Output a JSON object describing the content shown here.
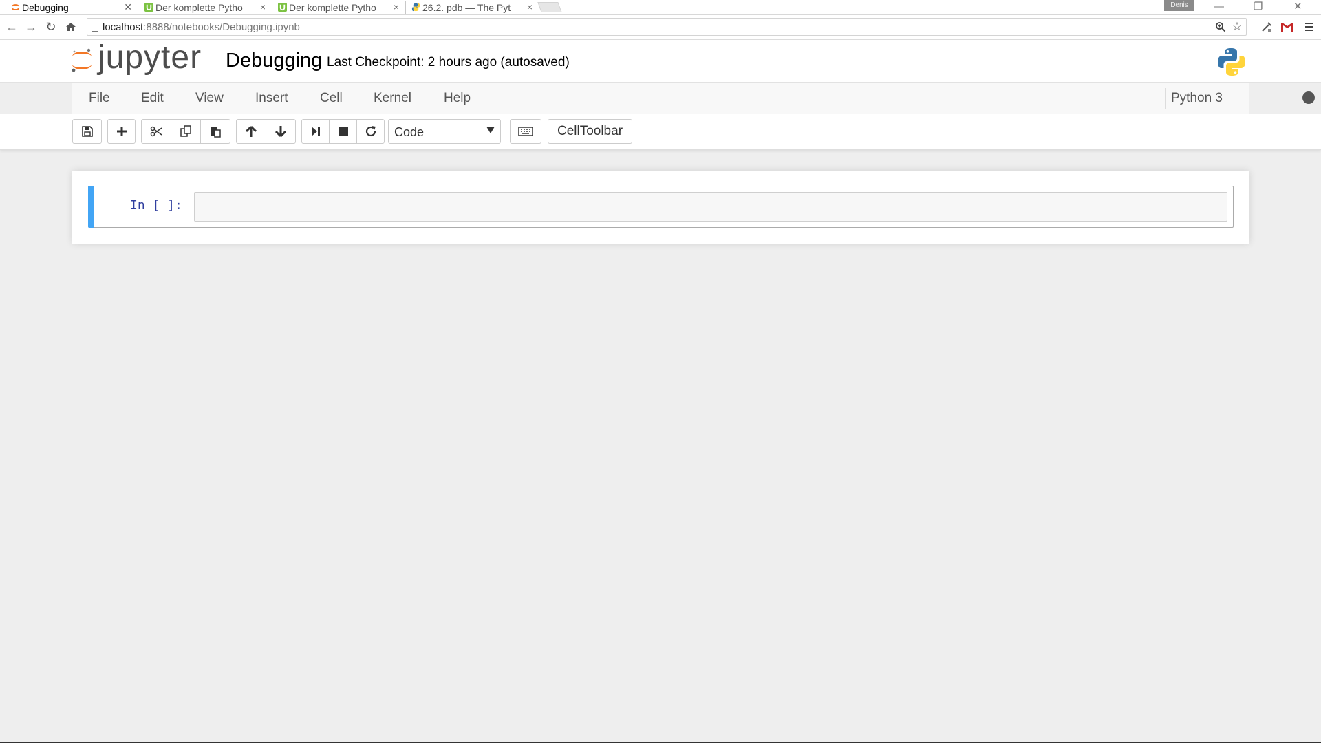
{
  "browser": {
    "tabs": [
      {
        "title": "Debugging",
        "active": true
      },
      {
        "title": "Der komplette Pytho",
        "active": false
      },
      {
        "title": "Der komplette Pytho",
        "active": false
      },
      {
        "title": "26.2. pdb — The Pyt",
        "active": false
      }
    ],
    "user_badge": "Denis",
    "url_host": "localhost",
    "url_rest": ":8888/notebooks/Debugging.ipynb"
  },
  "jupyter": {
    "logo_text": "jupyter",
    "notebook_name": "Debugging",
    "checkpoint": "Last Checkpoint: 2 hours ago (autosaved)",
    "menu": [
      "File",
      "Edit",
      "View",
      "Insert",
      "Cell",
      "Kernel",
      "Help"
    ],
    "kernel_name": "Python 3",
    "cell_type": "Code",
    "celltoolbar_label": "CellToolbar",
    "cell_prompt": "In [ ]:",
    "cell_source": ""
  },
  "colors": {
    "accent_cell_bar": "#42a5f5",
    "prompt": "#303f9f",
    "jupyter_orange": "#f37726"
  }
}
